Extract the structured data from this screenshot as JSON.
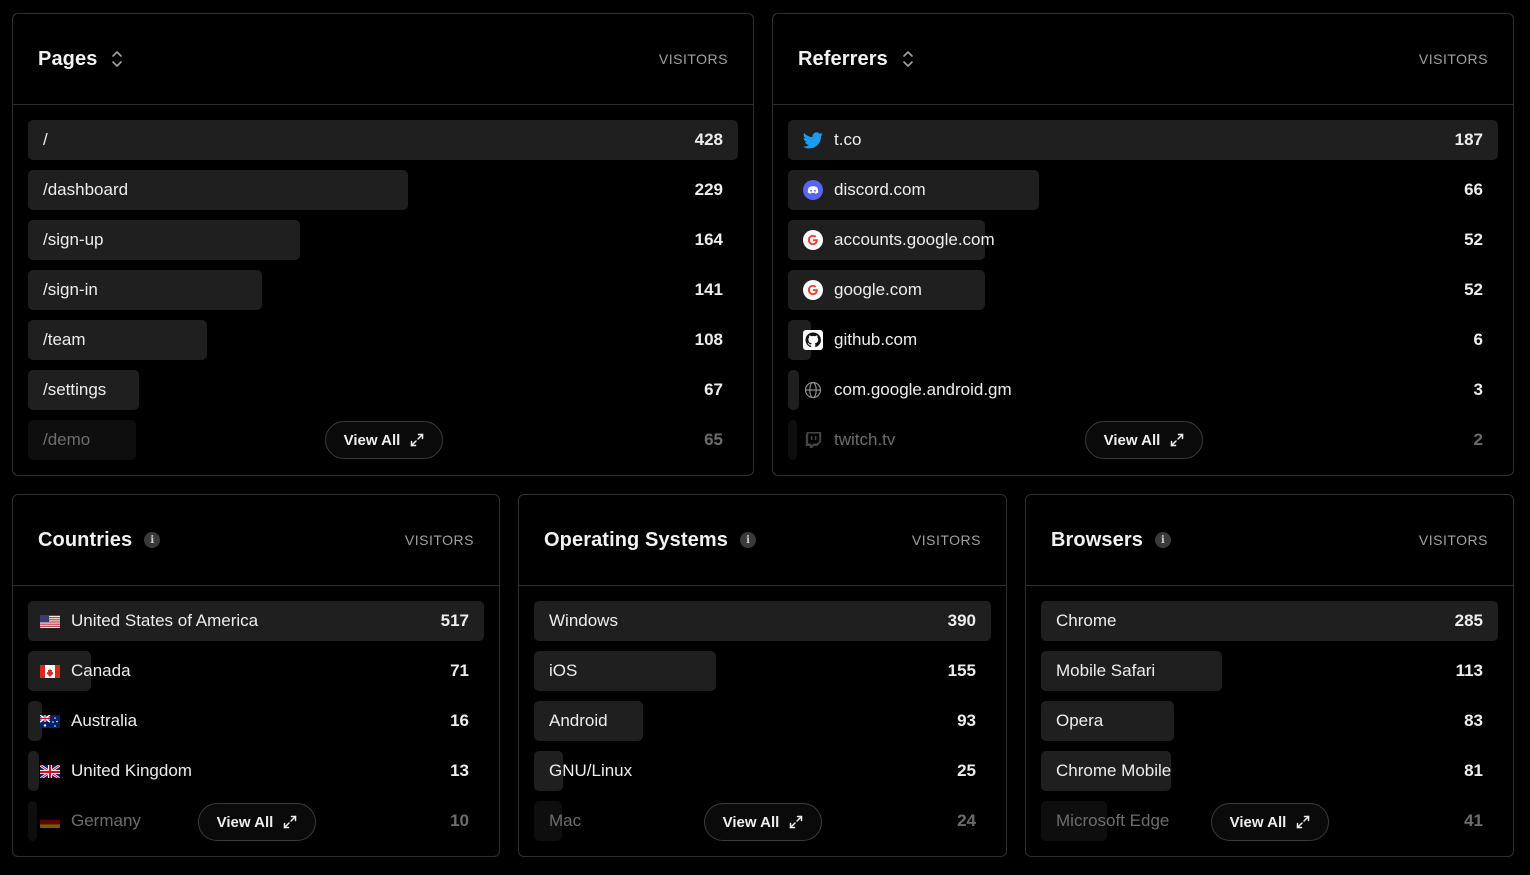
{
  "pages": {
    "title": "Pages",
    "col_label": "VISITORS",
    "view_all": "View All",
    "max": 428,
    "rows": [
      {
        "label": "/",
        "value": "428",
        "n": 428
      },
      {
        "label": "/dashboard",
        "value": "229",
        "n": 229
      },
      {
        "label": "/sign-up",
        "value": "164",
        "n": 164
      },
      {
        "label": "/sign-in",
        "value": "141",
        "n": 141
      },
      {
        "label": "/team",
        "value": "108",
        "n": 108
      },
      {
        "label": "/settings",
        "value": "67",
        "n": 67
      },
      {
        "label": "/demo",
        "value": "65",
        "n": 65
      }
    ]
  },
  "referrers": {
    "title": "Referrers",
    "col_label": "VISITORS",
    "view_all": "View All",
    "max": 187,
    "rows": [
      {
        "label": "t.co",
        "value": "187",
        "n": 187,
        "icon": "twitter-icon"
      },
      {
        "label": "discord.com",
        "value": "66",
        "n": 66,
        "icon": "discord-icon"
      },
      {
        "label": "accounts.google.com",
        "value": "52",
        "n": 52,
        "icon": "google-icon"
      },
      {
        "label": "google.com",
        "value": "52",
        "n": 52,
        "icon": "google-icon"
      },
      {
        "label": "github.com",
        "value": "6",
        "n": 6,
        "icon": "github-icon"
      },
      {
        "label": "com.google.android.gm",
        "value": "3",
        "n": 3,
        "icon": "globe-icon"
      },
      {
        "label": "twitch.tv",
        "value": "2",
        "n": 2,
        "icon": "twitch-icon"
      }
    ]
  },
  "countries": {
    "title": "Countries",
    "col_label": "VISITORS",
    "view_all": "View All",
    "max": 517,
    "rows": [
      {
        "label": "United States of America",
        "value": "517",
        "n": 517,
        "flag": "us"
      },
      {
        "label": "Canada",
        "value": "71",
        "n": 71,
        "flag": "ca"
      },
      {
        "label": "Australia",
        "value": "16",
        "n": 16,
        "flag": "au"
      },
      {
        "label": "United Kingdom",
        "value": "13",
        "n": 13,
        "flag": "gb"
      },
      {
        "label": "Germany",
        "value": "10",
        "n": 10,
        "flag": "de"
      }
    ]
  },
  "os": {
    "title": "Operating Systems",
    "col_label": "VISITORS",
    "view_all": "View All",
    "max": 390,
    "rows": [
      {
        "label": "Windows",
        "value": "390",
        "n": 390
      },
      {
        "label": "iOS",
        "value": "155",
        "n": 155
      },
      {
        "label": "Android",
        "value": "93",
        "n": 93
      },
      {
        "label": "GNU/Linux",
        "value": "25",
        "n": 25
      },
      {
        "label": "Mac",
        "value": "24",
        "n": 24
      }
    ]
  },
  "browsers": {
    "title": "Browsers",
    "col_label": "VISITORS",
    "view_all": "View All",
    "max": 285,
    "rows": [
      {
        "label": "Chrome",
        "value": "285",
        "n": 285
      },
      {
        "label": "Mobile Safari",
        "value": "113",
        "n": 113
      },
      {
        "label": "Opera",
        "value": "83",
        "n": 83
      },
      {
        "label": "Chrome Mobile",
        "value": "81",
        "n": 81
      },
      {
        "label": "Microsoft Edge",
        "value": "41",
        "n": 41
      }
    ]
  }
}
